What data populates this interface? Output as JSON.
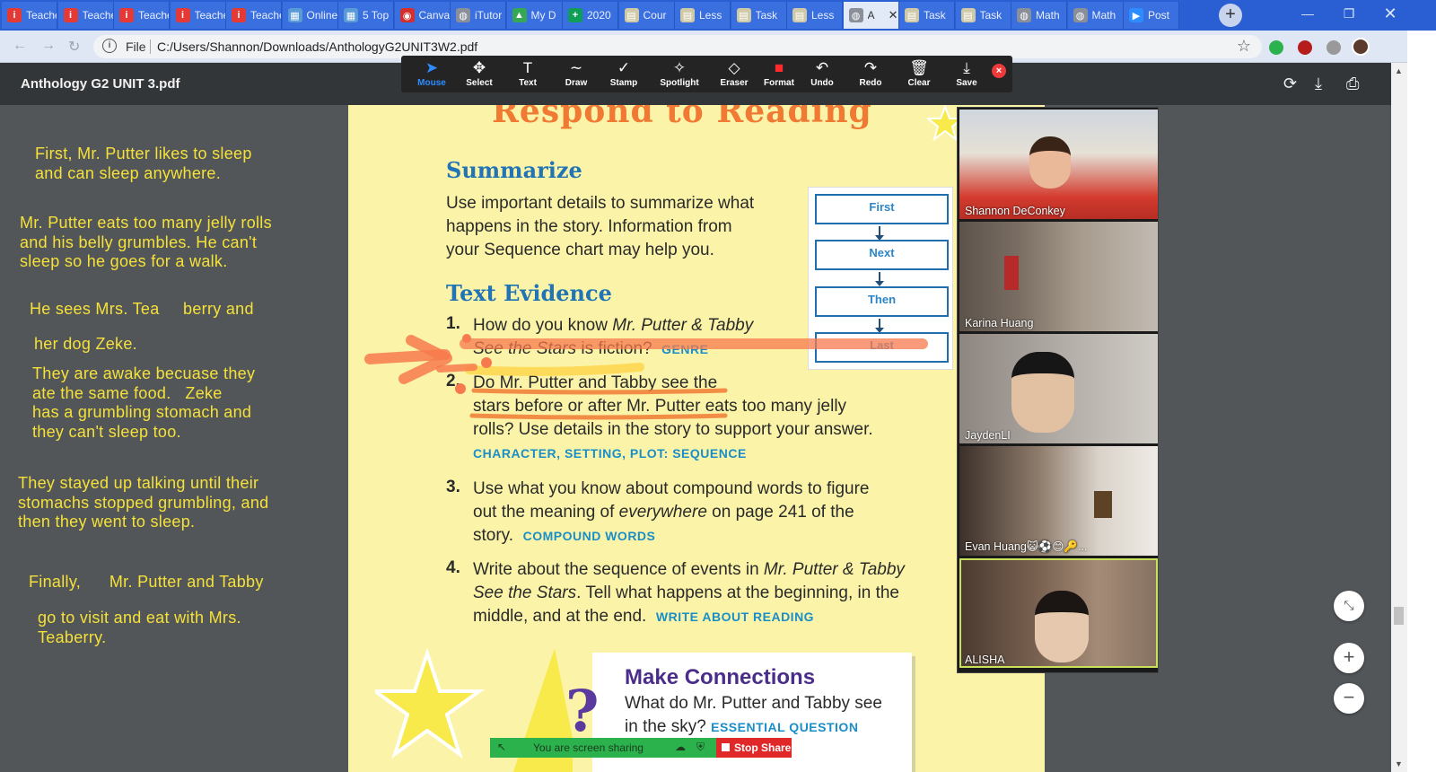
{
  "browser": {
    "tabs": [
      {
        "label": "Teacher",
        "icon": "teachable-icon",
        "color": "#e53935",
        "glyph": "i"
      },
      {
        "label": "Teacher",
        "icon": "teachable-icon",
        "color": "#e53935",
        "glyph": "i"
      },
      {
        "label": "Teacher",
        "icon": "teachable-icon",
        "color": "#e53935",
        "glyph": "i"
      },
      {
        "label": "Teacher",
        "icon": "teachable-icon",
        "color": "#e53935",
        "glyph": "i"
      },
      {
        "label": "Teacher",
        "icon": "teachable-icon",
        "color": "#e53935",
        "glyph": "i"
      },
      {
        "label": "Online",
        "icon": "school-icon",
        "color": "#5b9bd5",
        "glyph": "▦"
      },
      {
        "label": "5 Top",
        "icon": "school-icon",
        "color": "#5b9bd5",
        "glyph": "▦"
      },
      {
        "label": "Canva",
        "icon": "canva-icon",
        "color": "#d32f2f",
        "glyph": "◉"
      },
      {
        "label": "iTutor",
        "icon": "globe-icon",
        "color": "#8a8f99",
        "glyph": "◍"
      },
      {
        "label": "My D",
        "icon": "drive-icon",
        "color": "#34a853",
        "glyph": "▲"
      },
      {
        "label": "2020",
        "icon": "sheets-icon",
        "color": "#0f9d58",
        "glyph": "+"
      },
      {
        "label": "Cour",
        "icon": "course-icon",
        "color": "#cfc9a8",
        "glyph": "▤"
      },
      {
        "label": "Less",
        "icon": "course-icon",
        "color": "#cfc9a8",
        "glyph": "▤"
      },
      {
        "label": "Task",
        "icon": "course-icon",
        "color": "#cfc9a8",
        "glyph": "▤"
      },
      {
        "label": "Less",
        "icon": "course-icon",
        "color": "#cfc9a8",
        "glyph": "▤"
      },
      {
        "label": "A",
        "icon": "pdf-icon",
        "color": "#8a8f99",
        "glyph": "◍",
        "active": true
      },
      {
        "label": "Task",
        "icon": "course-icon",
        "color": "#cfc9a8",
        "glyph": "▤"
      },
      {
        "label": "Task",
        "icon": "course-icon",
        "color": "#cfc9a8",
        "glyph": "▤"
      },
      {
        "label": "Math",
        "icon": "globe-icon",
        "color": "#8a8f99",
        "glyph": "◍"
      },
      {
        "label": "Math",
        "icon": "globe-icon",
        "color": "#8a8f99",
        "glyph": "◍"
      },
      {
        "label": "Post",
        "icon": "zoom-icon",
        "color": "#2d8cff",
        "glyph": "▶"
      }
    ],
    "new_tab_label": "+",
    "address": {
      "scheme_label": "File",
      "url": "C:/Users/Shannon/Downloads/AnthologyG2UNIT3W2.pdf"
    }
  },
  "pdf_viewer": {
    "title": "Anthology G2 UNIT 3.pdf"
  },
  "annotation_toolbar": {
    "tools": [
      {
        "name": "mouse",
        "label": "Mouse",
        "glyph": "➤",
        "active": true
      },
      {
        "name": "select",
        "label": "Select",
        "glyph": "✥"
      },
      {
        "name": "text",
        "label": "Text",
        "glyph": "T"
      },
      {
        "name": "draw",
        "label": "Draw",
        "glyph": "∼"
      },
      {
        "name": "stamp",
        "label": "Stamp",
        "glyph": "✓"
      },
      {
        "name": "spotlight",
        "label": "Spotlight",
        "glyph": "✧"
      },
      {
        "name": "eraser",
        "label": "Eraser",
        "glyph": "◇"
      },
      {
        "name": "format",
        "label": "Format",
        "glyph": "■",
        "color": "#ff2a2a"
      },
      {
        "name": "undo",
        "label": "Undo",
        "glyph": "↶"
      },
      {
        "name": "redo",
        "label": "Redo",
        "glyph": "↷"
      },
      {
        "name": "clear",
        "label": "Clear",
        "glyph": "🗑"
      },
      {
        "name": "save",
        "label": "Save",
        "glyph": "⤓"
      }
    ],
    "close_label": "×"
  },
  "notes": [
    "First, Mr. Putter likes to sleep\nand can sleep anywhere.",
    "Mr. Putter eats too many jelly rolls\nand his belly grumbles. He can't\nsleep so he goes for a walk.",
    "He sees Mrs. Tea     berry and",
    "her dog Zeke.",
    "They are awake becuase they\nate the same food.   Zeke\nhas a grumbling stomach and\nthey can't sleep too.",
    "They stayed up talking until their\nstomachs stopped grumbling, and\nthen they went to sleep.",
    "Finally,      Mr. Putter and Tabby",
    "go to visit and eat with Mrs.\nTeaberry."
  ],
  "page": {
    "heading": "Respond to Reading",
    "summarize": {
      "title": "Summarize",
      "lines": [
        "Use important details to summarize what",
        "happens in the story. Information from",
        "your Sequence chart may help you."
      ]
    },
    "sequence_chart": [
      "First",
      "Next",
      "Then",
      "Last"
    ],
    "text_evidence": {
      "title": "Text Evidence",
      "questions": [
        {
          "num": "1.",
          "html_lines": [
            "How do you know <i>Mr. Putter &amp; Tabby</i>",
            "<i>See the Stars</i> is fiction?&nbsp; <span class=\"tag\" data-name=\"skill-tag\" data-interactable=\"false\">GENRE</span>"
          ]
        },
        {
          "num": "2.",
          "html_lines": [
            "Do Mr. Putter and Tabby see the",
            "stars before or after Mr. Putter eats too many jelly",
            "rolls? Use details in the story to support your answer.",
            "<span class=\"tag\" data-name=\"skill-tag\" data-interactable=\"false\">CHARACTER, SETTING, PLOT: SEQUENCE</span>"
          ]
        },
        {
          "num": "3.",
          "html_lines": [
            "Use what you know about compound words to figure",
            "out the meaning of <i>everywhere</i> on page 241 of the",
            "story.&nbsp; <span class=\"tag\" data-name=\"skill-tag\" data-interactable=\"false\">COMPOUND WORDS</span>"
          ]
        },
        {
          "num": "4.",
          "html_lines": [
            "Write about the sequence of events in <i>Mr. Putter &amp; Tabby</i>",
            "<i>See the Stars</i>. Tell what happens at the beginning, in the",
            "middle, and at the end.&nbsp; <span class=\"tag\" data-name=\"skill-tag\" data-interactable=\"false\">WRITE ABOUT READING</span>"
          ]
        }
      ]
    },
    "make_connections": {
      "title": "Make Connections",
      "line1": "What do Mr. Putter and Tabby see",
      "line2": "in the sky?",
      "tag": "ESSENTIAL QUESTION"
    }
  },
  "participants": [
    {
      "name": "Shannon DeConkey"
    },
    {
      "name": "Karina Huang"
    },
    {
      "name": "JaydenLI"
    },
    {
      "name": "Evan Huang😺⚽😊🔑..."
    },
    {
      "name": "ALISHA",
      "active": true
    }
  ],
  "sharing": {
    "status": "You are screen sharing",
    "stop_label": "Stop Share"
  },
  "colors": {
    "notes_text": "#f5e13a",
    "page_bg": "#fbf4a8",
    "heading": "#f07a34",
    "section_title": "#2174b5",
    "skill_tag": "#1a8ec9",
    "browser_frame": "#2a5fd4",
    "annotation_orange": "#f77a4e",
    "annotation_yellow": "#ffcf3a"
  }
}
